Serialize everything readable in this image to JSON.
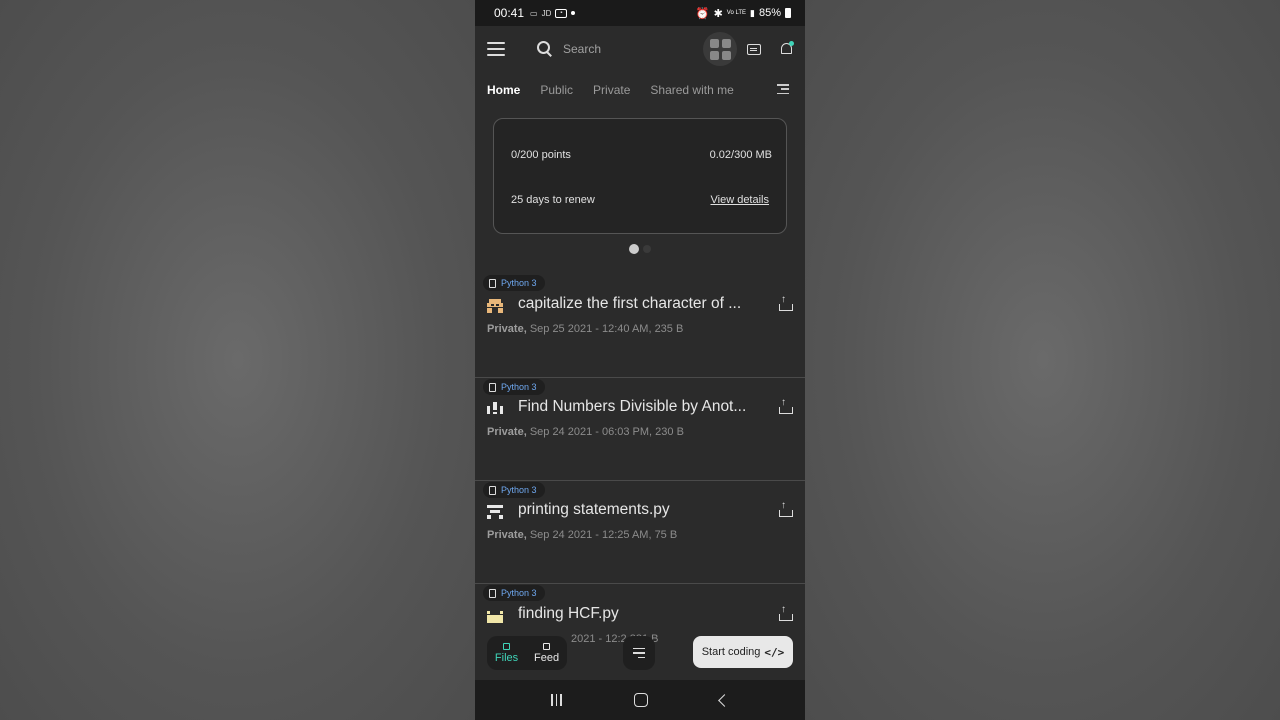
{
  "status_bar": {
    "time": "00:41",
    "battery": "85%",
    "indicators": [
      "JD",
      "Vo LTE"
    ]
  },
  "search": {
    "placeholder": "Search"
  },
  "tabs": [
    {
      "label": "Home",
      "active": true
    },
    {
      "label": "Public",
      "active": false
    },
    {
      "label": "Private",
      "active": false
    },
    {
      "label": "Shared with me",
      "active": false
    }
  ],
  "plan_card": {
    "points": "0/200 points",
    "storage": "0.02/300 MB",
    "renew": "25 days to renew",
    "details_link": "View details"
  },
  "files": [
    {
      "language": "Python 3",
      "title": "capitalize the first character  of ...",
      "visibility": "Private,",
      "meta": "Sep 25 2021 - 12:40 AM,  235 B"
    },
    {
      "language": "Python 3",
      "title": "Find Numbers Divisible by Anot...",
      "visibility": "Private,",
      "meta": "Sep 24 2021 - 06:03 PM,  230 B"
    },
    {
      "language": "Python 3",
      "title": "printing statements.py",
      "visibility": "Private,",
      "meta": "Sep 24 2021 - 12:25 AM,  75 B"
    },
    {
      "language": "Python 3",
      "title": "finding HCF.py",
      "visibility": "",
      "meta": "2021 - 12:2      381 B"
    }
  ],
  "bottom_nav": {
    "files": "Files",
    "feed": "Feed"
  },
  "start_coding": "Start coding",
  "colors": {
    "accent": "#3fd4b8",
    "language_badge": "#6fa8f0",
    "background": "#2b2b2b"
  }
}
